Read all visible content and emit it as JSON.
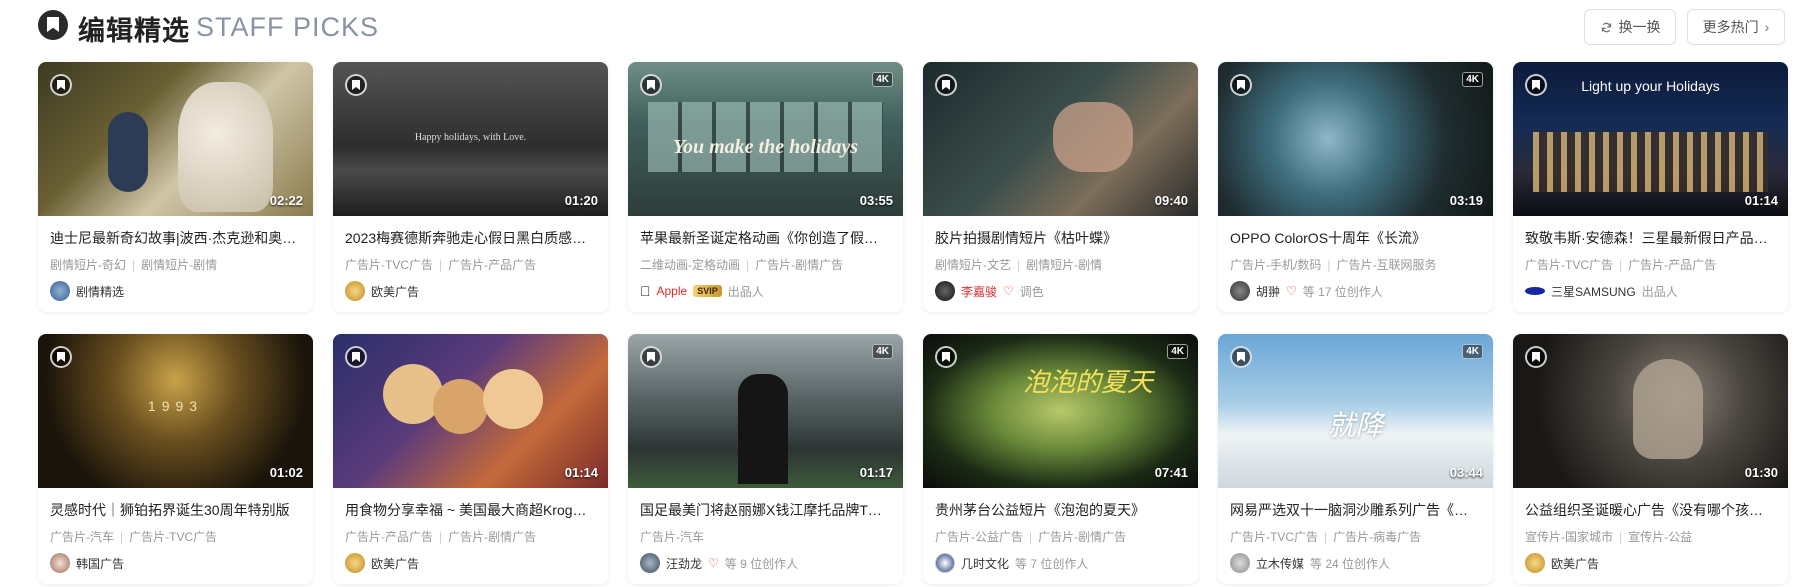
{
  "header": {
    "title_cn": "编辑精选",
    "title_en": "STAFF PICKS",
    "refresh_label": "换一换",
    "more_label": "更多热门"
  },
  "cards": [
    {
      "title": "迪士尼最新奇幻故事|波西·杰克逊和奥…",
      "tags": [
        "剧情短片-奇幻",
        "剧情短片-剧情"
      ],
      "duration": "02:22",
      "author": "剧情精选",
      "author_extra": "",
      "badge_4k": "",
      "overlay": ""
    },
    {
      "title": "2023梅赛德斯奔驰走心假日黑白质感…",
      "tags": [
        "广告片-TVC广告",
        "广告片-产品广告"
      ],
      "duration": "01:20",
      "author": "欧美广告",
      "author_extra": "",
      "badge_4k": "",
      "overlay": "Happy holidays, with Love."
    },
    {
      "title": "苹果最新圣诞定格动画《你创造了假…",
      "tags": [
        "二维动画-定格动画",
        "广告片-剧情广告"
      ],
      "duration": "03:55",
      "author": "Apple",
      "author_extra": "出品人",
      "badge_4k": "4K",
      "overlay": "You make the holidays",
      "svip": "SVIP"
    },
    {
      "title": "胶片拍摄剧情短片《枯叶蝶》",
      "tags": [
        "剧情短片-文艺",
        "剧情短片-剧情"
      ],
      "duration": "09:40",
      "author": "李嘉骏",
      "author_extra": "调色",
      "badge_4k": "",
      "overlay": ""
    },
    {
      "title": "OPPO ColorOS十周年《长流》",
      "tags": [
        "广告片-手机/数码",
        "广告片-互联网服务"
      ],
      "duration": "03:19",
      "author": "胡翀",
      "author_extra": "等 17 位创作人",
      "badge_4k": "4K",
      "overlay": ""
    },
    {
      "title": "致敬韦斯·安德森！三星最新假日产品…",
      "tags": [
        "广告片-TVC广告",
        "广告片-产品广告"
      ],
      "duration": "01:14",
      "author": "三星SAMSUNG",
      "author_extra": "出品人",
      "badge_4k": "",
      "overlay": "Light up your Holidays"
    },
    {
      "title": "灵感时代｜狮铂拓界诞生30周年特别版",
      "tags": [
        "广告片-汽车",
        "广告片-TVC广告"
      ],
      "duration": "01:02",
      "author": "韩国广告",
      "author_extra": "",
      "badge_4k": "",
      "overlay": "1993"
    },
    {
      "title": "用食物分享幸福 ~ 美国最大商超Krog…",
      "tags": [
        "广告片-产品广告",
        "广告片-剧情广告"
      ],
      "duration": "01:14",
      "author": "欧美广告",
      "author_extra": "",
      "badge_4k": "",
      "overlay": ""
    },
    {
      "title": "国足最美门将赵丽娜X钱江摩托品牌T…",
      "tags": [
        "广告片-汽车"
      ],
      "duration": "01:17",
      "author": "汪劲龙",
      "author_extra": "等 9 位创作人",
      "badge_4k": "4K",
      "overlay": ""
    },
    {
      "title": "贵州茅台公益短片《泡泡的夏天》",
      "tags": [
        "广告片-公益广告",
        "广告片-剧情广告"
      ],
      "duration": "07:41",
      "author": "几时文化",
      "author_extra": "等 7 位创作人",
      "badge_4k": "4K",
      "overlay": "泡泡的夏天"
    },
    {
      "title": "网易严选双十一脑洞沙雕系列广告《…",
      "tags": [
        "广告片-TVC广告",
        "广告片-病毒广告"
      ],
      "duration": "03:44",
      "author": "立木传媒",
      "author_extra": "等 24 位创作人",
      "badge_4k": "4K",
      "overlay": "就降"
    },
    {
      "title": "公益组织圣诞暖心广告《没有哪个孩…",
      "tags": [
        "宣传片-国家城市",
        "宣传片-公益"
      ],
      "duration": "01:30",
      "author": "欧美广告",
      "author_extra": "",
      "badge_4k": "",
      "overlay": ""
    }
  ],
  "colors": {
    "title_en": "#8a93a5",
    "tag_text": "#999999",
    "red_name": "#e02a2a"
  }
}
